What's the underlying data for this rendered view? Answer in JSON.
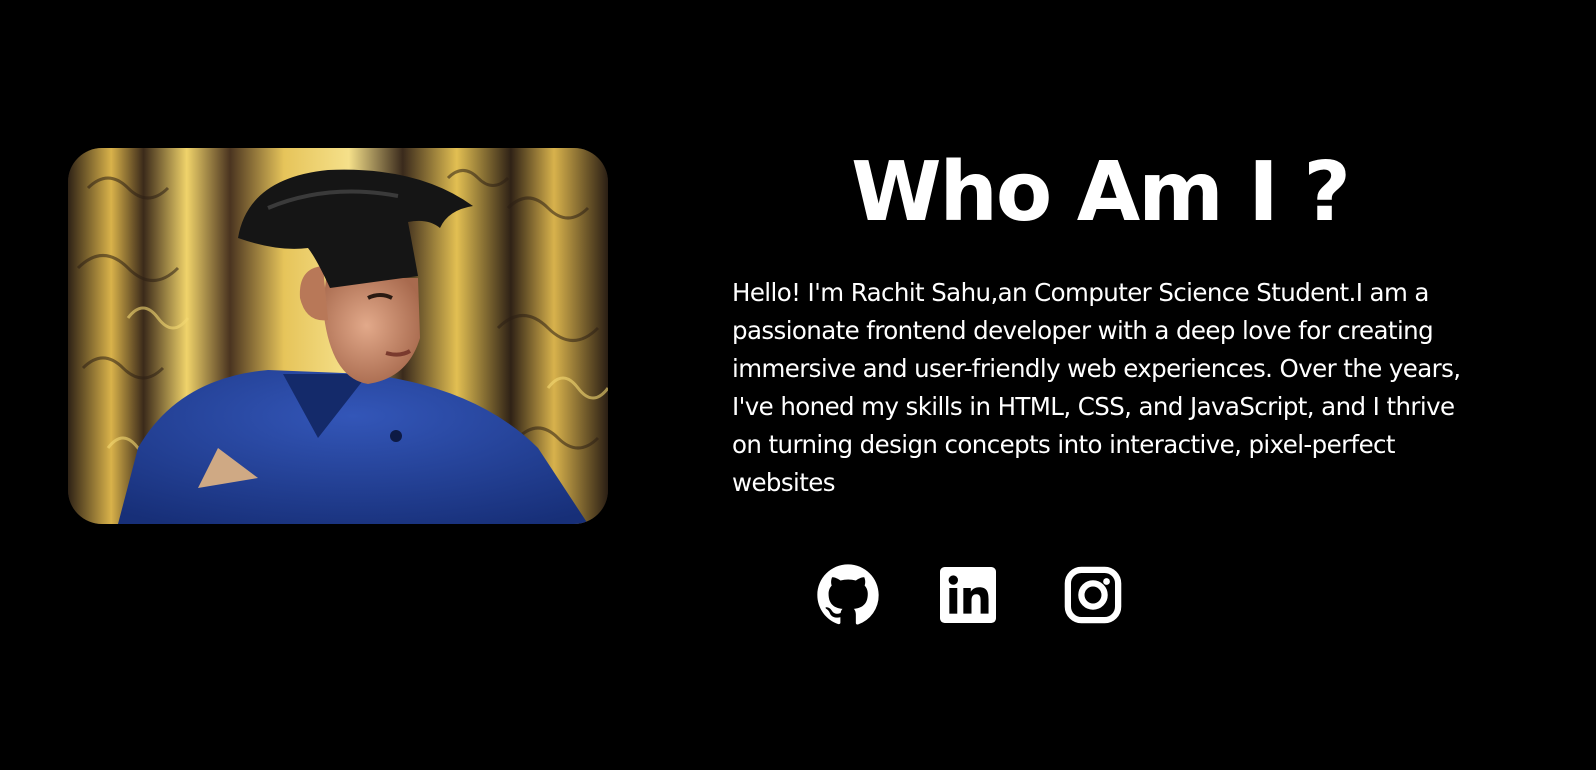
{
  "about": {
    "heading": "Who Am I ?",
    "bio": "Hello! I'm Rachit Sahu,an Computer Science Student.I am a passionate frontend developer with a deep love for creating immersive and user-friendly web experiences. Over the years, I've honed my skills in HTML, CSS, and JavaScript, and I thrive on turning design concepts into interactive, pixel-perfect websites",
    "photo": {
      "alt": "Profile photo"
    }
  },
  "socials": [
    {
      "icon": "github-icon"
    },
    {
      "icon": "linkedin-icon"
    },
    {
      "icon": "instagram-icon"
    }
  ],
  "colors": {
    "background": "#000000",
    "text": "#ffffff",
    "curtain_gold": "#e8c24a",
    "curtain_dark": "#3a2a1c",
    "shirt_blue": "#1f3f9a"
  }
}
